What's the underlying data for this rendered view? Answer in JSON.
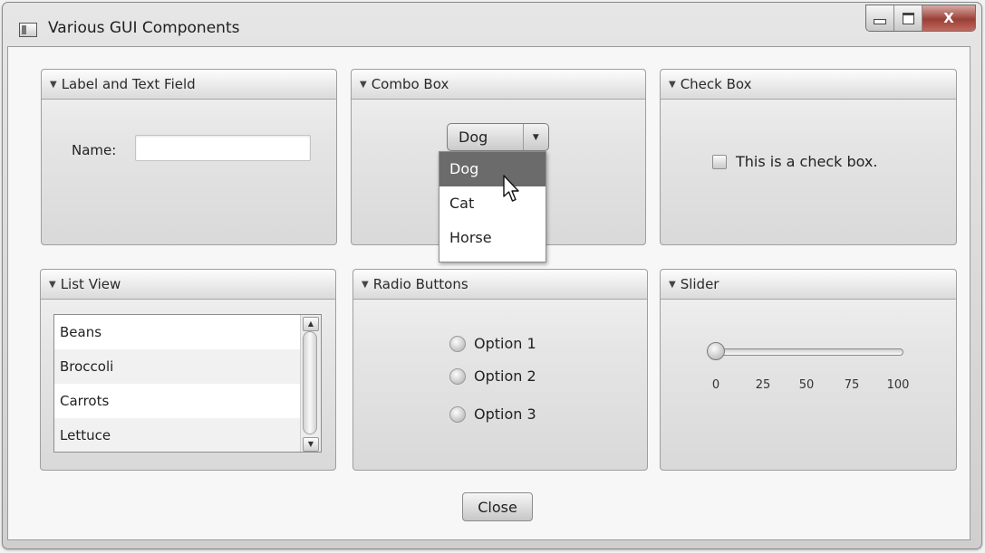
{
  "window": {
    "title": "Various GUI Components",
    "controls": {
      "minimize": "",
      "maximize": "",
      "close": "X"
    }
  },
  "panes": {
    "label_text": {
      "title": "Label and Text Field",
      "label": "Name:",
      "field_value": ""
    },
    "combo": {
      "title": "Combo Box",
      "selected": "Dog",
      "options": [
        "Dog",
        "Cat",
        "Horse"
      ],
      "highlighted": "Dog",
      "open": true
    },
    "checkbox": {
      "title": "Check Box",
      "label": "This is a check box.",
      "checked": false
    },
    "list_view": {
      "title": "List View",
      "items": [
        "Beans",
        "Broccoli",
        "Carrots",
        "Lettuce"
      ]
    },
    "radio": {
      "title": "Radio Buttons",
      "options": [
        "Option 1",
        "Option 2",
        "Option 3"
      ]
    },
    "slider": {
      "title": "Slider",
      "min": 0,
      "max": 100,
      "value": 0,
      "ticks": [
        "0",
        "25",
        "50",
        "75",
        "100"
      ]
    }
  },
  "footer": {
    "close_label": "Close"
  }
}
